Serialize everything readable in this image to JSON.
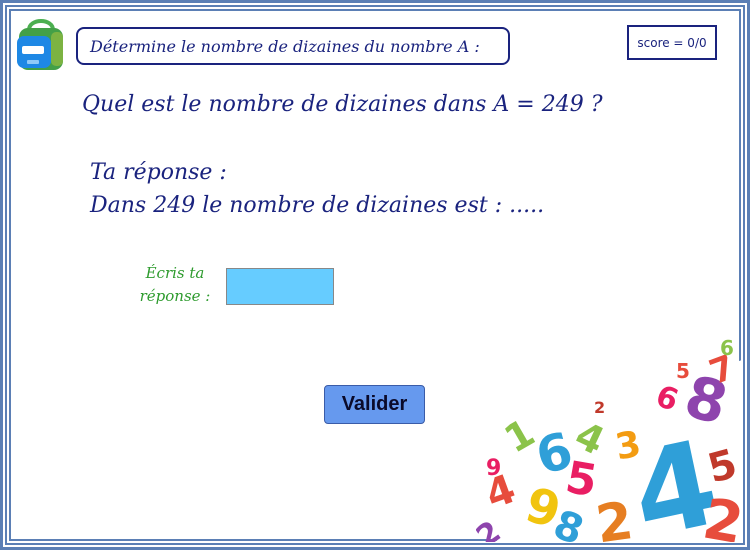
{
  "header": {
    "instruction": "Détermine le nombre de dizaines du nombre A :",
    "score": "score = 0/0"
  },
  "exercise": {
    "question": "Quel est le nombre de dizaines dans A = 249 ?",
    "answer_title": "Ta réponse :",
    "answer_sentence": "Dans 249 le nombre de dizaines est : ....."
  },
  "form": {
    "prompt_line1": "Écris ta",
    "prompt_line2": "réponse :",
    "input_value": "",
    "submit_label": "Valider"
  },
  "icons": {
    "backpack": "backpack-icon",
    "decoration": "colorful-numbers-illustration"
  },
  "colors": {
    "frame": "#5b7fb5",
    "text": "#1a237e",
    "prompt": "#2e9b2e",
    "input_bg": "#66ccff",
    "button_bg": "#6699ee"
  }
}
